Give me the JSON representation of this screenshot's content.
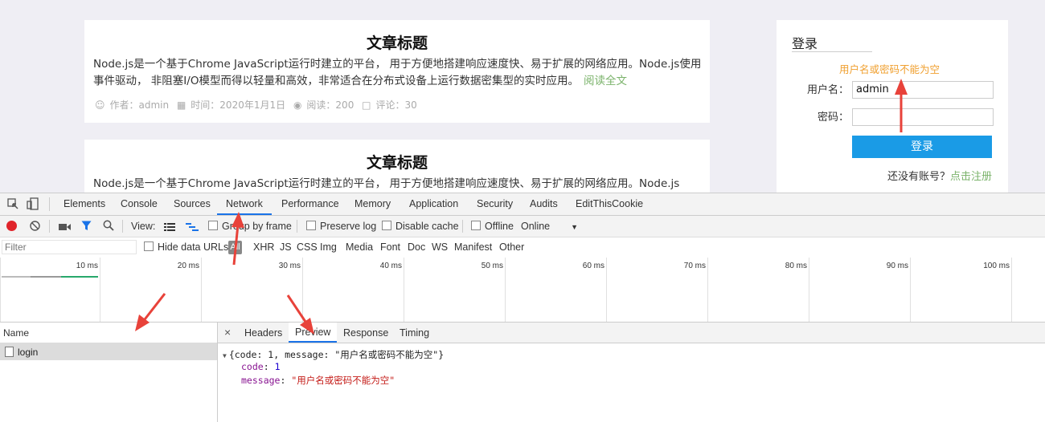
{
  "articles": [
    {
      "title": "文章标题",
      "body": "Node.js是一个基于Chrome JavaScript运行时建立的平台， 用于方便地搭建响应速度快、易于扩展的网络应用。Node.js使用事件驱动， 非阻塞I/O模型而得以轻量和高效，非常适合在分布式设备上运行数据密集型的实时应用。",
      "read_more": "阅读全文",
      "author": "作者：admin",
      "time": "时间：2020年1月1日",
      "reads": "阅读：200",
      "comments": "评论：30"
    },
    {
      "title": "文章标题",
      "body": "Node.js是一个基于Chrome JavaScript运行时建立的平台， 用于方便地搭建响应速度快、易于扩展的网络应用。Node.js"
    }
  ],
  "login": {
    "title": "登录",
    "error": "用户名或密码不能为空",
    "username_label": "用户名：",
    "username_value": "admin",
    "password_label": "密码：",
    "password_value": "",
    "submit": "登录",
    "no_account": "还没有账号？",
    "register_link": "点击注册"
  },
  "devtools": {
    "tabs": [
      "Elements",
      "Console",
      "Sources",
      "Network",
      "Performance",
      "Memory",
      "Application",
      "Security",
      "Audits",
      "EditThisCookie"
    ],
    "active_tab": "Network",
    "toolbar": {
      "view_label": "View:",
      "group_by_frame": "Group by frame",
      "preserve_log": "Preserve log",
      "disable_cache": "Disable cache",
      "offline": "Offline",
      "throttle": "Online"
    },
    "filter": {
      "placeholder": "Filter",
      "hide_data_urls": "Hide data URLs",
      "types": [
        "All",
        "XHR",
        "JS",
        "CSS",
        "Img",
        "Media",
        "Font",
        "Doc",
        "WS",
        "Manifest",
        "Other"
      ]
    },
    "timeline_ticks": [
      "10 ms",
      "20 ms",
      "30 ms",
      "40 ms",
      "50 ms",
      "60 ms",
      "70 ms",
      "80 ms",
      "90 ms",
      "100 ms"
    ],
    "name_header": "Name",
    "requests": [
      "login"
    ],
    "detail_tabs": [
      "Headers",
      "Preview",
      "Response",
      "Timing"
    ],
    "active_detail_tab": "Preview",
    "close_glyph": "×",
    "preview": {
      "summary": "{code: 1, message: \"用户名或密码不能为空\"}",
      "code_key": "code",
      "code_value": "1",
      "message_key": "message",
      "message_value": "\"用户名或密码不能为空\""
    }
  },
  "colors": {
    "accent": "#1a73e8",
    "login_button": "#1a9be6",
    "error_text": "#f0a030",
    "link_green": "#7bb36b",
    "annotation_arrow": "#e8423a"
  }
}
